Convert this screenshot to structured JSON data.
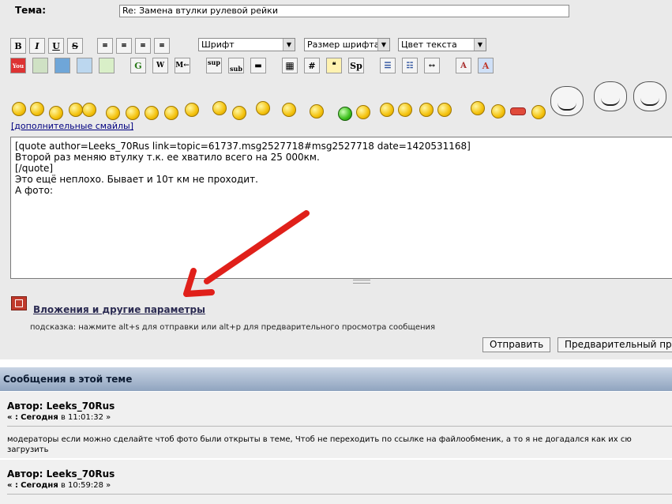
{
  "form": {
    "subject_label": "Тема:",
    "subject_value": "Re: Замена втулки рулевой рейки",
    "font_select": "Шрифт",
    "size_select": "Размер шрифта",
    "color_select": "Цвет текста",
    "btn_bold": "B",
    "btn_italic": "I",
    "btn_underline": "U",
    "btn_strike": "S",
    "btn_google": "G",
    "btn_sup": "sup",
    "btn_sub": "sub",
    "btn_hash": "#",
    "btn_spoiler": "Sp",
    "btn_ml": "M←",
    "more_smileys": "[дополнительные смайлы]",
    "message_lines": [
      "[quote author=Leeks_70Rus link=topic=61737.msg2527718#msg2527718 date=1420531168]",
      "Второй раз меняю втулку т.к. ее хватило всего на 25 000км.",
      "[/quote]",
      "Это ещё неплохо. Бывает и 10т км не проходит.",
      "А фото:"
    ],
    "attachments_link": "Вложения и другие параметры",
    "hint": "подсказка: нажмите alt+s для отправки или alt+p для предварительного просмотра сообщения",
    "send_button": "Отправить",
    "preview_button": "Предварительный пр"
  },
  "thread": {
    "header": "Сообщения в этой теме",
    "posts": [
      {
        "author": "Автор: Leeks_70Rus",
        "date_prefix": "« :",
        "date_day": "Сегодня",
        "date_rest": "в 11:01:32 »",
        "body": "модераторы если можно сделайте чтоб фото были открыты в теме, Чтоб не переходить по ссылке на файлообменик, а то я не догадался как их сю загрузить"
      },
      {
        "author": "Автор: Leeks_70Rus",
        "date_prefix": "« :",
        "date_day": "Сегодня",
        "date_rest": "в 10:59:28 »",
        "body": ""
      }
    ]
  },
  "colors": {
    "arrow": "#e0201a",
    "form_bg": "#eaeaea",
    "header_bg": "#90a4bf"
  }
}
